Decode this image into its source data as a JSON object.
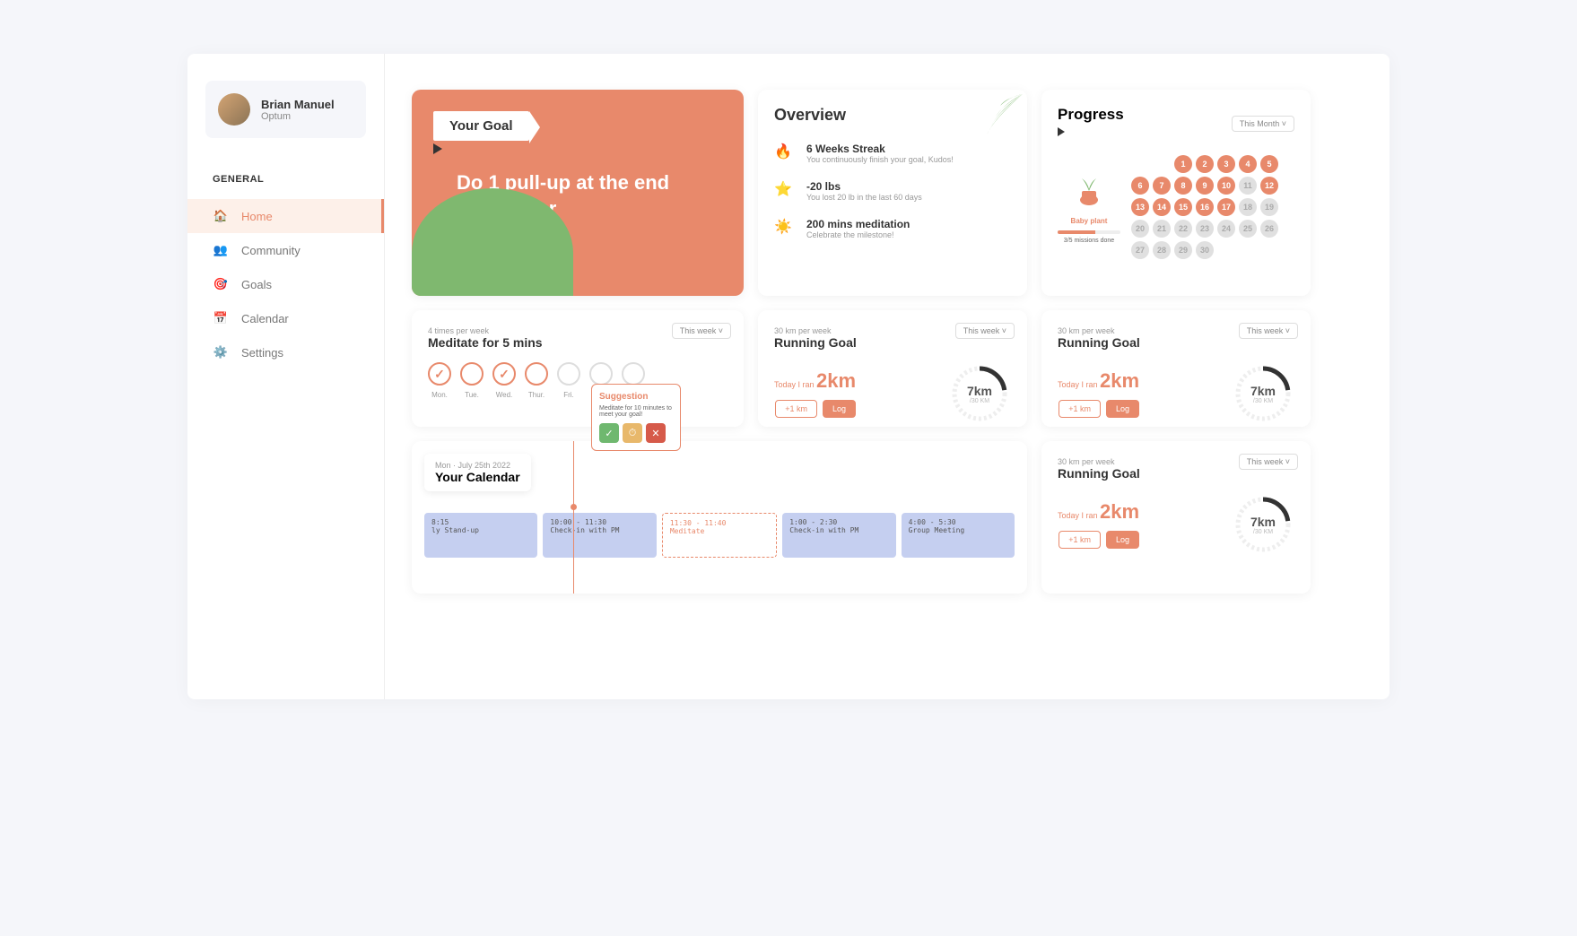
{
  "profile": {
    "name": "Brian Manuel",
    "org": "Optum"
  },
  "section_label": "GENERAL",
  "nav": [
    {
      "label": "Home",
      "active": true
    },
    {
      "label": "Community",
      "active": false
    },
    {
      "label": "Goals",
      "active": false
    },
    {
      "label": "Calendar",
      "active": false
    },
    {
      "label": "Settings",
      "active": false
    }
  ],
  "goal": {
    "badge": "Your Goal",
    "text": "Do 1 pull-up at the end of the year"
  },
  "overview": {
    "title": "Overview",
    "items": [
      {
        "title": "6 Weeks Streak",
        "sub": "You continuously finish your goal, Kudos!"
      },
      {
        "title": "-20 lbs",
        "sub": "You lost 20 lb in the last 60 days"
      },
      {
        "title": "200 mins meditation",
        "sub": "Celebrate the milestone!"
      }
    ]
  },
  "progress": {
    "title": "Progress",
    "dropdown": "This Month ˅",
    "plant_name": "Baby plant",
    "missions_text": "3/5 missions done",
    "days": [
      {
        "n": 1,
        "d": true
      },
      {
        "n": 2,
        "d": true
      },
      {
        "n": 3,
        "d": true
      },
      {
        "n": 4,
        "d": true
      },
      {
        "n": 5,
        "d": true
      },
      {
        "n": 6,
        "d": true
      },
      {
        "n": 7,
        "d": true
      },
      {
        "n": 8,
        "d": true
      },
      {
        "n": 9,
        "d": true
      },
      {
        "n": 10,
        "d": true
      },
      {
        "n": 11,
        "d": false
      },
      {
        "n": 12,
        "d": true
      },
      {
        "n": 13,
        "d": true
      },
      {
        "n": 14,
        "d": true
      },
      {
        "n": 15,
        "d": true
      },
      {
        "n": 16,
        "d": true
      },
      {
        "n": 17,
        "d": true
      },
      {
        "n": 18,
        "d": false
      },
      {
        "n": 19,
        "d": false
      },
      {
        "n": 20,
        "d": false
      },
      {
        "n": 21,
        "d": false
      },
      {
        "n": 22,
        "d": false
      },
      {
        "n": 23,
        "d": false
      },
      {
        "n": 24,
        "d": false
      },
      {
        "n": 25,
        "d": false
      },
      {
        "n": 26,
        "d": false
      },
      {
        "n": 27,
        "d": false
      },
      {
        "n": 28,
        "d": false
      },
      {
        "n": 29,
        "d": false
      },
      {
        "n": 30,
        "d": false
      }
    ]
  },
  "habit": {
    "sub": "4 times per week",
    "title": "Meditate for 5 mins",
    "dropdown": "This week ˅",
    "days": [
      {
        "label": "Mon.",
        "state": "checked"
      },
      {
        "label": "Tue.",
        "state": "open"
      },
      {
        "label": "Wed.",
        "state": "checked"
      },
      {
        "label": "Thur.",
        "state": "open"
      },
      {
        "label": "Fri.",
        "state": "grey"
      },
      {
        "label": "Sat.",
        "state": "grey"
      },
      {
        "label": "Sun.",
        "state": "grey"
      }
    ]
  },
  "running": {
    "sub": "30 km per week",
    "title": "Running Goal",
    "dropdown": "This week ˅",
    "today_label": "Today I ran",
    "value": "2km",
    "gauge_val": "7km",
    "gauge_sub": "/30 KM",
    "btn_add": "+1 km",
    "btn_log": "Log"
  },
  "calendar": {
    "date": "Mon · July 25th 2022",
    "title": "Your Calendar",
    "events": [
      {
        "time": "8:15",
        "title": "ly Stand-up",
        "dash": false
      },
      {
        "time": "10:00 - 11:30",
        "title": "Check-in with PM",
        "dash": false
      },
      {
        "time": "11:30 - 11:40",
        "title": "Meditate",
        "dash": true
      },
      {
        "time": "1:00 - 2:30",
        "title": "Check-in with PM",
        "dash": false
      },
      {
        "time": "4:00 - 5:30",
        "title": "Group Meeting",
        "dash": false
      }
    ],
    "suggestion": {
      "title": "Suggestion",
      "text": "Meditate for 10 minutes to meet your goal!"
    }
  }
}
